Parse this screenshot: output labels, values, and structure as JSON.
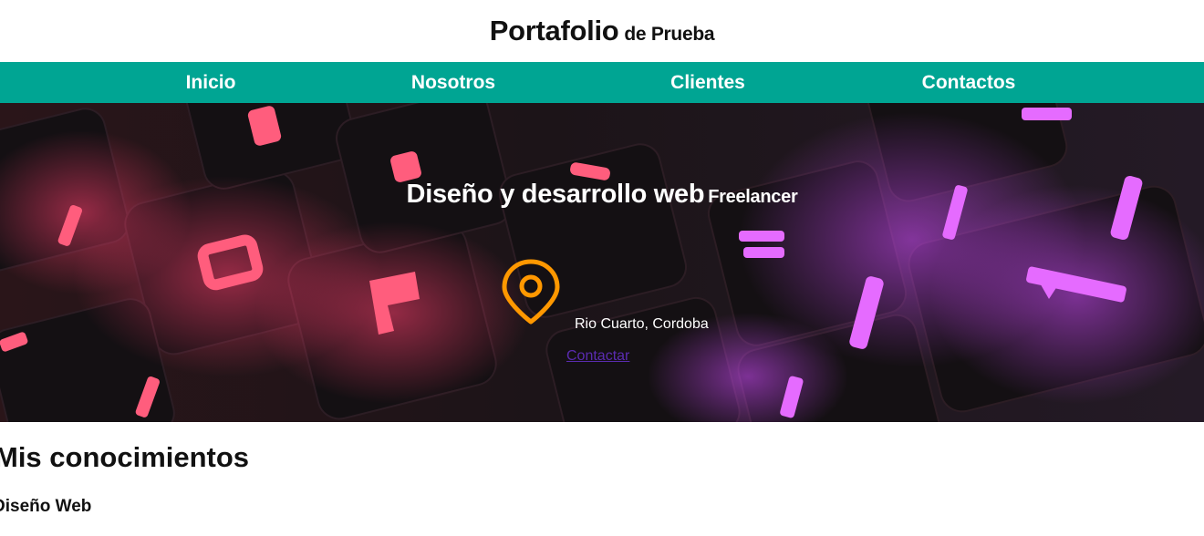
{
  "header": {
    "title": "Portafolio",
    "subtitle": "de Prueba"
  },
  "nav": {
    "items": [
      {
        "label": "Inicio"
      },
      {
        "label": "Nosotros"
      },
      {
        "label": "Clientes"
      },
      {
        "label": "Contactos"
      }
    ]
  },
  "hero": {
    "heading": "Diseño y desarrollo web",
    "heading_small": "Freelancer",
    "location_icon": "map-pin-icon",
    "location": "Rio Cuarto, Cordoba",
    "contact_link": "Contactar"
  },
  "skills": {
    "title": "Mis conocimientos",
    "items": [
      "Diseño Web"
    ]
  },
  "colors": {
    "nav_bg": "#00a593",
    "pin": "#ff9800",
    "link": "#5a2bb0"
  }
}
